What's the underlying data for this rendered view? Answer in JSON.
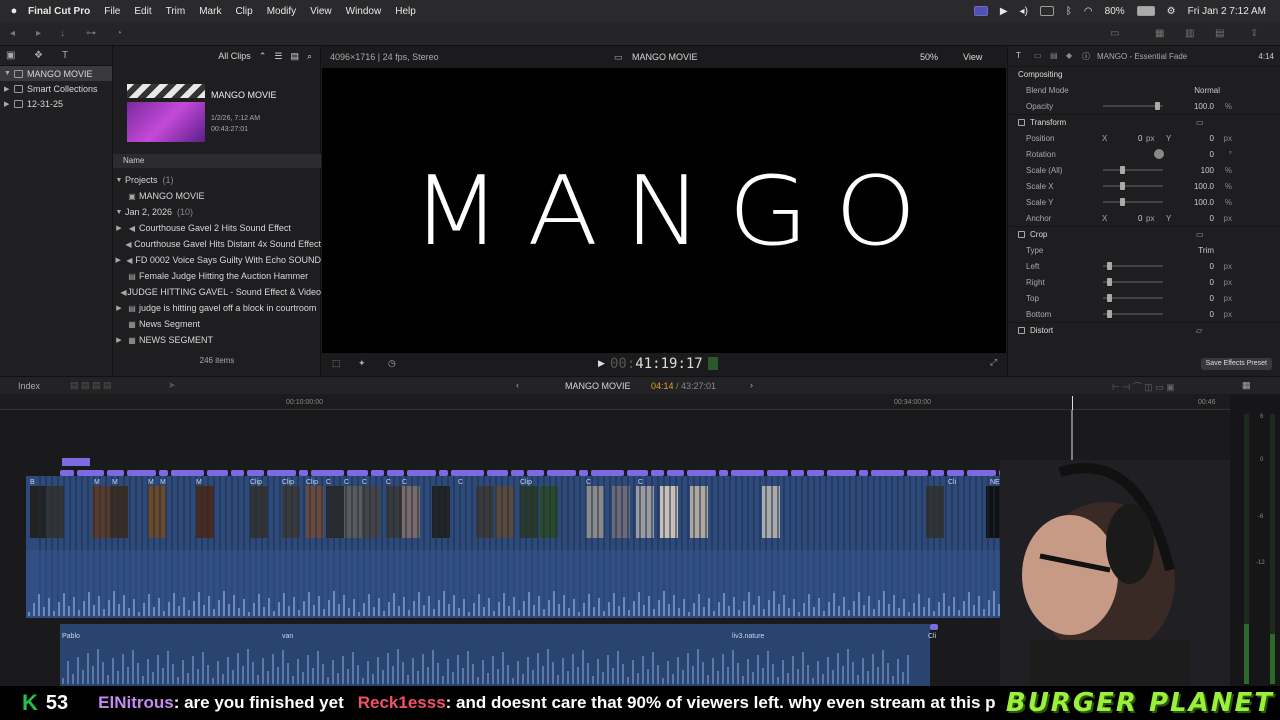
{
  "menubar": {
    "apple": "",
    "app_name": "Final Cut Pro",
    "items": [
      "File",
      "Edit",
      "Trim",
      "Mark",
      "Clip",
      "Modify",
      "View",
      "Window",
      "Help"
    ],
    "battery": "80%",
    "clock": "Fri Jan 2  7:12 AM"
  },
  "browser_toolbar": {
    "filter": "All Clips"
  },
  "libraries": {
    "items": [
      {
        "label": "MANGO MOVIE",
        "selected": true
      },
      {
        "label": "Smart Collections",
        "selected": false
      },
      {
        "label": "12-31-25",
        "selected": false
      }
    ]
  },
  "project_card": {
    "name": "MANGO MOVIE",
    "date": "1/2/26, 7:12 AM",
    "duration": "00:43:27:01"
  },
  "browser": {
    "column_header": "Name",
    "rows": [
      {
        "type": "group",
        "label": "Projects",
        "count": "(1)"
      },
      {
        "type": "project",
        "label": "MANGO MOVIE"
      },
      {
        "type": "group",
        "label": "Jan 2, 2026",
        "count": "(10)"
      },
      {
        "type": "audio",
        "label": "Courthouse Gavel 2 Hits Sound Effect"
      },
      {
        "type": "audio",
        "label": "Courthouse Gavel Hits Distant 4x Sound Effect"
      },
      {
        "type": "audio",
        "label": "FD 0002   Voice Says Guilty With Echo SOUND"
      },
      {
        "type": "clip",
        "label": "Female Judge Hitting the Auction Hammer"
      },
      {
        "type": "audio",
        "label": "JUDGE HITTING GAVEL - Sound Effect & Video"
      },
      {
        "type": "clip",
        "label": "judge is hitting gavel off a block in courtroom"
      },
      {
        "type": "clip",
        "label": "News Segment"
      },
      {
        "type": "clip",
        "label": "NEWS SEGMENT"
      }
    ],
    "item_count": "246 items"
  },
  "viewer": {
    "format": "4096×1716 | 24 fps, Stereo",
    "project": "MANGO MOVIE",
    "zoom": "50%",
    "view_menu": "View",
    "title_text": "MANGO",
    "timecode": "41:19:17",
    "timecode_prefix": "00:"
  },
  "inspector": {
    "clip_name": "MANGO - Essential Fade",
    "duration": "4:14",
    "compositing_label": "Compositing",
    "blend_mode_label": "Blend Mode",
    "blend_mode_value": "Normal",
    "opacity_label": "Opacity",
    "opacity_value": "100.0",
    "opacity_unit": "%",
    "transform_label": "Transform",
    "position_label": "Position",
    "position_x": "0",
    "position_y": "0",
    "rotation_label": "Rotation",
    "rotation_value": "0",
    "rotation_unit": "°",
    "scale_all_label": "Scale (All)",
    "scale_all_value": "100",
    "scale_x_label": "Scale X",
    "scale_x_value": "100.0",
    "scale_y_label": "Scale Y",
    "scale_y_value": "100.0",
    "anchor_label": "Anchor",
    "anchor_x": "0",
    "anchor_y": "0",
    "crop_label": "Crop",
    "type_label": "Type",
    "type_value": "Trim",
    "left_label": "Left",
    "left_value": "0",
    "right_label": "Right",
    "right_value": "0",
    "top_label": "Top",
    "top_value": "0",
    "bottom_label": "Bottom",
    "bottom_value": "0",
    "distort_label": "Distort",
    "px": "px",
    "pct": "%",
    "x": "X",
    "y": "Y",
    "save_preset": "Save Effects Preset"
  },
  "timeline": {
    "index_label": "Index",
    "project": "MANGO MOVIE",
    "position": "04:14",
    "total": "43:27:01",
    "ruler_marks": [
      "00:10:00:00",
      "00:34:00:00",
      "00:46"
    ],
    "clip_labels": [
      "B",
      "M",
      "M",
      "M",
      "M",
      "M",
      "Clip",
      "Clip",
      "Clip",
      "C",
      "C",
      "C",
      "C",
      "C",
      "C",
      "Clip",
      "C",
      "C",
      "Cli",
      "NEWS S"
    ],
    "lower_labels": [
      "Pablo",
      "van",
      "liv3.nature",
      "Cli"
    ]
  },
  "meters": {
    "labels": [
      "6",
      "0",
      "-6",
      "-12"
    ]
  },
  "chat": {
    "k_badge": "K",
    "k_count": "53",
    "user1": "ElNitrous",
    "msg1": " : are you finished yet",
    "user2": "Reck1esss",
    "msg2": " : and doesnt care that 90% of viewers left. why even stream at this point",
    "brand": "BURGER PLANET"
  },
  "colors": {
    "accent": "#5a5ad8",
    "clip_blue": "#2e4a7a",
    "clip_purple": "#7b6ae0",
    "brand_green": "#9bf03c",
    "k_green": "#23c04a"
  }
}
